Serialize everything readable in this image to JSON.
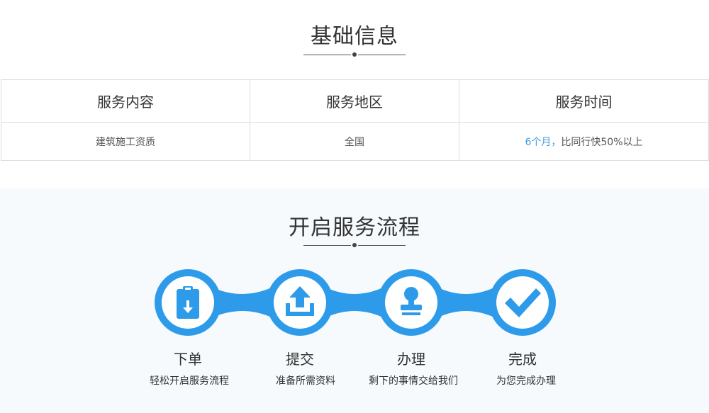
{
  "basic_info": {
    "title": "基础信息",
    "headers": [
      "服务内容",
      "服务地区",
      "服务时间"
    ],
    "row": {
      "content": "建筑施工资质",
      "region": "全国",
      "time_highlight": "6个月，",
      "time_rest": "比同行快50%以上"
    }
  },
  "process": {
    "title": "开启服务流程",
    "steps": [
      {
        "label": "下单",
        "desc": "轻松开启服务流程",
        "icon": "clipboard-download-icon"
      },
      {
        "label": "提交",
        "desc": "准备所需资料",
        "icon": "upload-tray-icon"
      },
      {
        "label": "办理",
        "desc": "剩下的事情交给我们",
        "icon": "stamp-icon"
      },
      {
        "label": "完成",
        "desc": "为您完成办理",
        "icon": "checkmark-icon"
      }
    ]
  },
  "colors": {
    "accent": "#2d9be9",
    "highlight_text": "#3a9be8",
    "process_bg": "#f6fafd",
    "border": "#dddddd"
  }
}
